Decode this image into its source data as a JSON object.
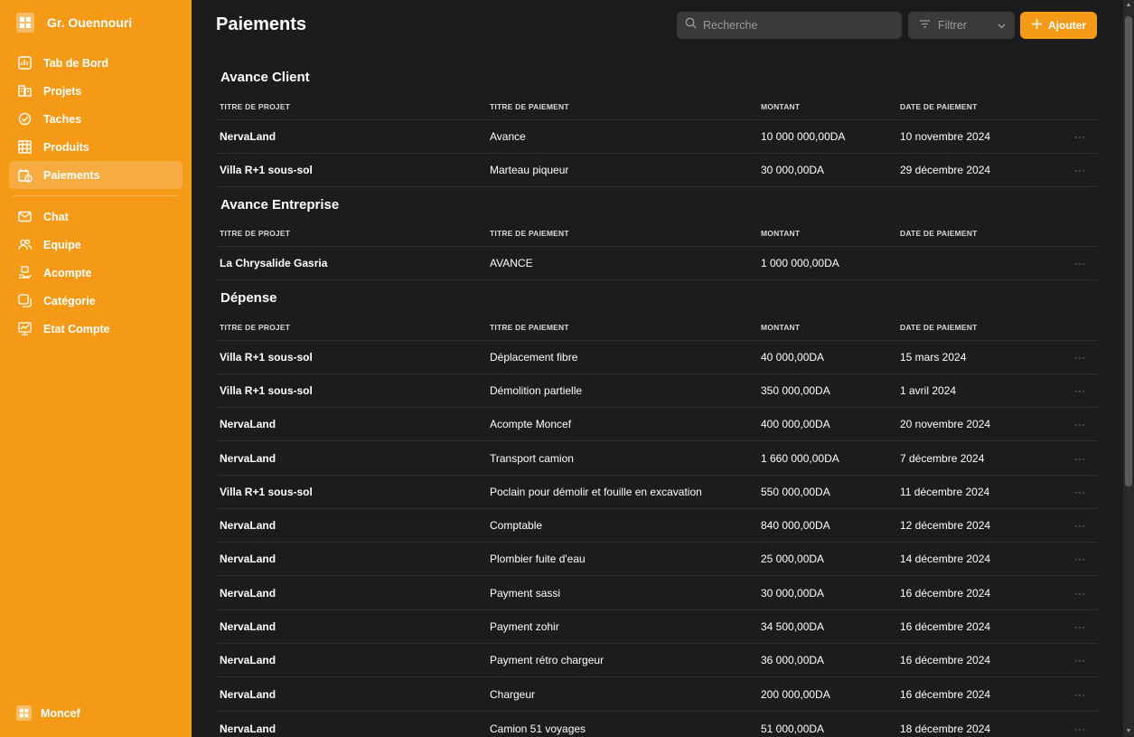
{
  "sidebar": {
    "brand": "Gr. Ouennouri",
    "items": [
      {
        "label": "Tab de Bord",
        "icon": "dashboard-icon"
      },
      {
        "label": "Projets",
        "icon": "projects-icon"
      },
      {
        "label": "Taches",
        "icon": "check-circle-icon"
      },
      {
        "label": "Produits",
        "icon": "products-icon"
      },
      {
        "label": "Paiements",
        "icon": "payments-icon",
        "active": true
      },
      {
        "label": "Chat",
        "icon": "chat-icon"
      },
      {
        "label": "Equipe",
        "icon": "team-icon"
      },
      {
        "label": "Acompte",
        "icon": "acompte-icon"
      },
      {
        "label": "Catégorie",
        "icon": "category-icon"
      },
      {
        "label": "Etat Compte",
        "icon": "account-state-icon"
      }
    ],
    "user": "Moncef"
  },
  "header": {
    "title": "Paiements",
    "search_placeholder": "Recherche",
    "filter_label": "Filtrer",
    "add_label": "Ajouter"
  },
  "columns": [
    "TITRE DE PROJET",
    "TITRE DE PAIEMENT",
    "MONTANT",
    "DATE DE PAIEMENT"
  ],
  "sections": [
    {
      "title": "Avance Client",
      "rows": [
        {
          "projet": "NervaLand",
          "paiement": "Avance",
          "montant": "10 000 000,00DA",
          "date": "10 novembre 2024"
        },
        {
          "projet": "Villa R+1 sous-sol",
          "paiement": "Marteau piqueur",
          "montant": "30 000,00DA",
          "date": "29 décembre 2024"
        }
      ]
    },
    {
      "title": "Avance Entreprise",
      "rows": [
        {
          "projet": "La Chrysalide Gasria",
          "paiement": "AVANCE",
          "montant": "1 000 000,00DA",
          "date": ""
        }
      ]
    },
    {
      "title": "Dépense",
      "rows": [
        {
          "projet": "Villa R+1 sous-sol",
          "paiement": "Déplacement fibre",
          "montant": "40 000,00DA",
          "date": "15 mars 2024"
        },
        {
          "projet": "Villa R+1 sous-sol",
          "paiement": "Démolition partielle",
          "montant": "350 000,00DA",
          "date": "1 avril 2024"
        },
        {
          "projet": "NervaLand",
          "paiement": "Acompte Moncef",
          "montant": "400 000,00DA",
          "date": "20 novembre 2024"
        },
        {
          "projet": "NervaLand",
          "paiement": "Transport camion",
          "montant": "1 660 000,00DA",
          "date": "7 décembre 2024"
        },
        {
          "projet": "Villa R+1 sous-sol",
          "paiement": "Poclain pour démolir et fouille en excavation",
          "montant": "550 000,00DA",
          "date": "11 décembre 2024"
        },
        {
          "projet": "NervaLand",
          "paiement": "Comptable",
          "montant": "840 000,00DA",
          "date": "12 décembre 2024"
        },
        {
          "projet": "NervaLand",
          "paiement": "Plombier fuite d'eau",
          "montant": "25 000,00DA",
          "date": "14 décembre 2024"
        },
        {
          "projet": "NervaLand",
          "paiement": "Payment sassi",
          "montant": "30 000,00DA",
          "date": "16 décembre 2024"
        },
        {
          "projet": "NervaLand",
          "paiement": "Payment zohir",
          "montant": "34 500,00DA",
          "date": "16 décembre 2024"
        },
        {
          "projet": "NervaLand",
          "paiement": "Payment rétro chargeur",
          "montant": "36 000,00DA",
          "date": "16 décembre 2024"
        },
        {
          "projet": "NervaLand",
          "paiement": "Chargeur",
          "montant": "200 000,00DA",
          "date": "16 décembre 2024"
        },
        {
          "projet": "NervaLand",
          "paiement": "Camion 51 voyages",
          "montant": "51 000,00DA",
          "date": "18 décembre 2024"
        }
      ]
    }
  ],
  "row_menu_glyph": "···",
  "colors": {
    "accent": "#f59a16",
    "background": "#1c1c1c",
    "input_bg": "#3a3a3a"
  }
}
